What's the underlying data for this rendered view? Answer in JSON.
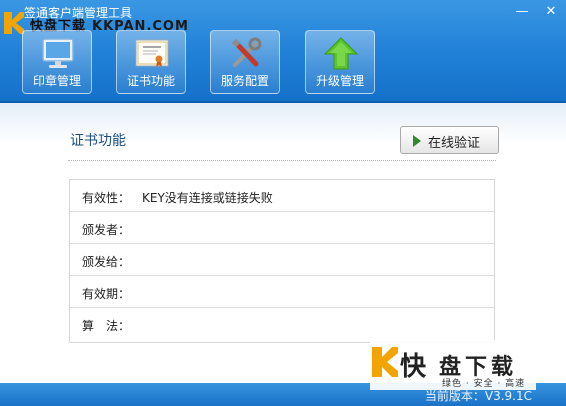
{
  "window": {
    "title": "签通客户端管理工具",
    "minimize_glyph": "—",
    "close_glyph": "✕"
  },
  "watermark_top": {
    "cn": "快盘下载",
    "latin": "KKPAN.COM"
  },
  "toolbar": {
    "items": [
      {
        "label": "印章管理",
        "icon": "monitor-icon"
      },
      {
        "label": "证书功能",
        "icon": "certificate-icon",
        "active": true
      },
      {
        "label": "服务配置",
        "icon": "tools-icon"
      },
      {
        "label": "升级管理",
        "icon": "upgrade-arrow-icon"
      }
    ]
  },
  "main": {
    "section_title": "证书功能",
    "verify_button": "在线验证",
    "rows": [
      {
        "label": "有效性：",
        "value": "KEY没有连接或链接失败"
      },
      {
        "label": "颁发者：",
        "value": ""
      },
      {
        "label": "颁发给：",
        "value": ""
      },
      {
        "label": "有效期：",
        "value": ""
      },
      {
        "label": "算　法：",
        "value": ""
      }
    ]
  },
  "footer": {
    "version": "当前版本：V3.9.1C"
  },
  "watermark_bottom": {
    "c1": "快",
    "c2": "盘",
    "c3": "下",
    "c4": "载",
    "sub": "绿色 · 安全 · 高速"
  },
  "colors": {
    "header_blue": "#1f7fd6",
    "footer_blue": "#1a72c7",
    "title_blue": "#1b4f82",
    "play_green": "#2f8a2f"
  }
}
